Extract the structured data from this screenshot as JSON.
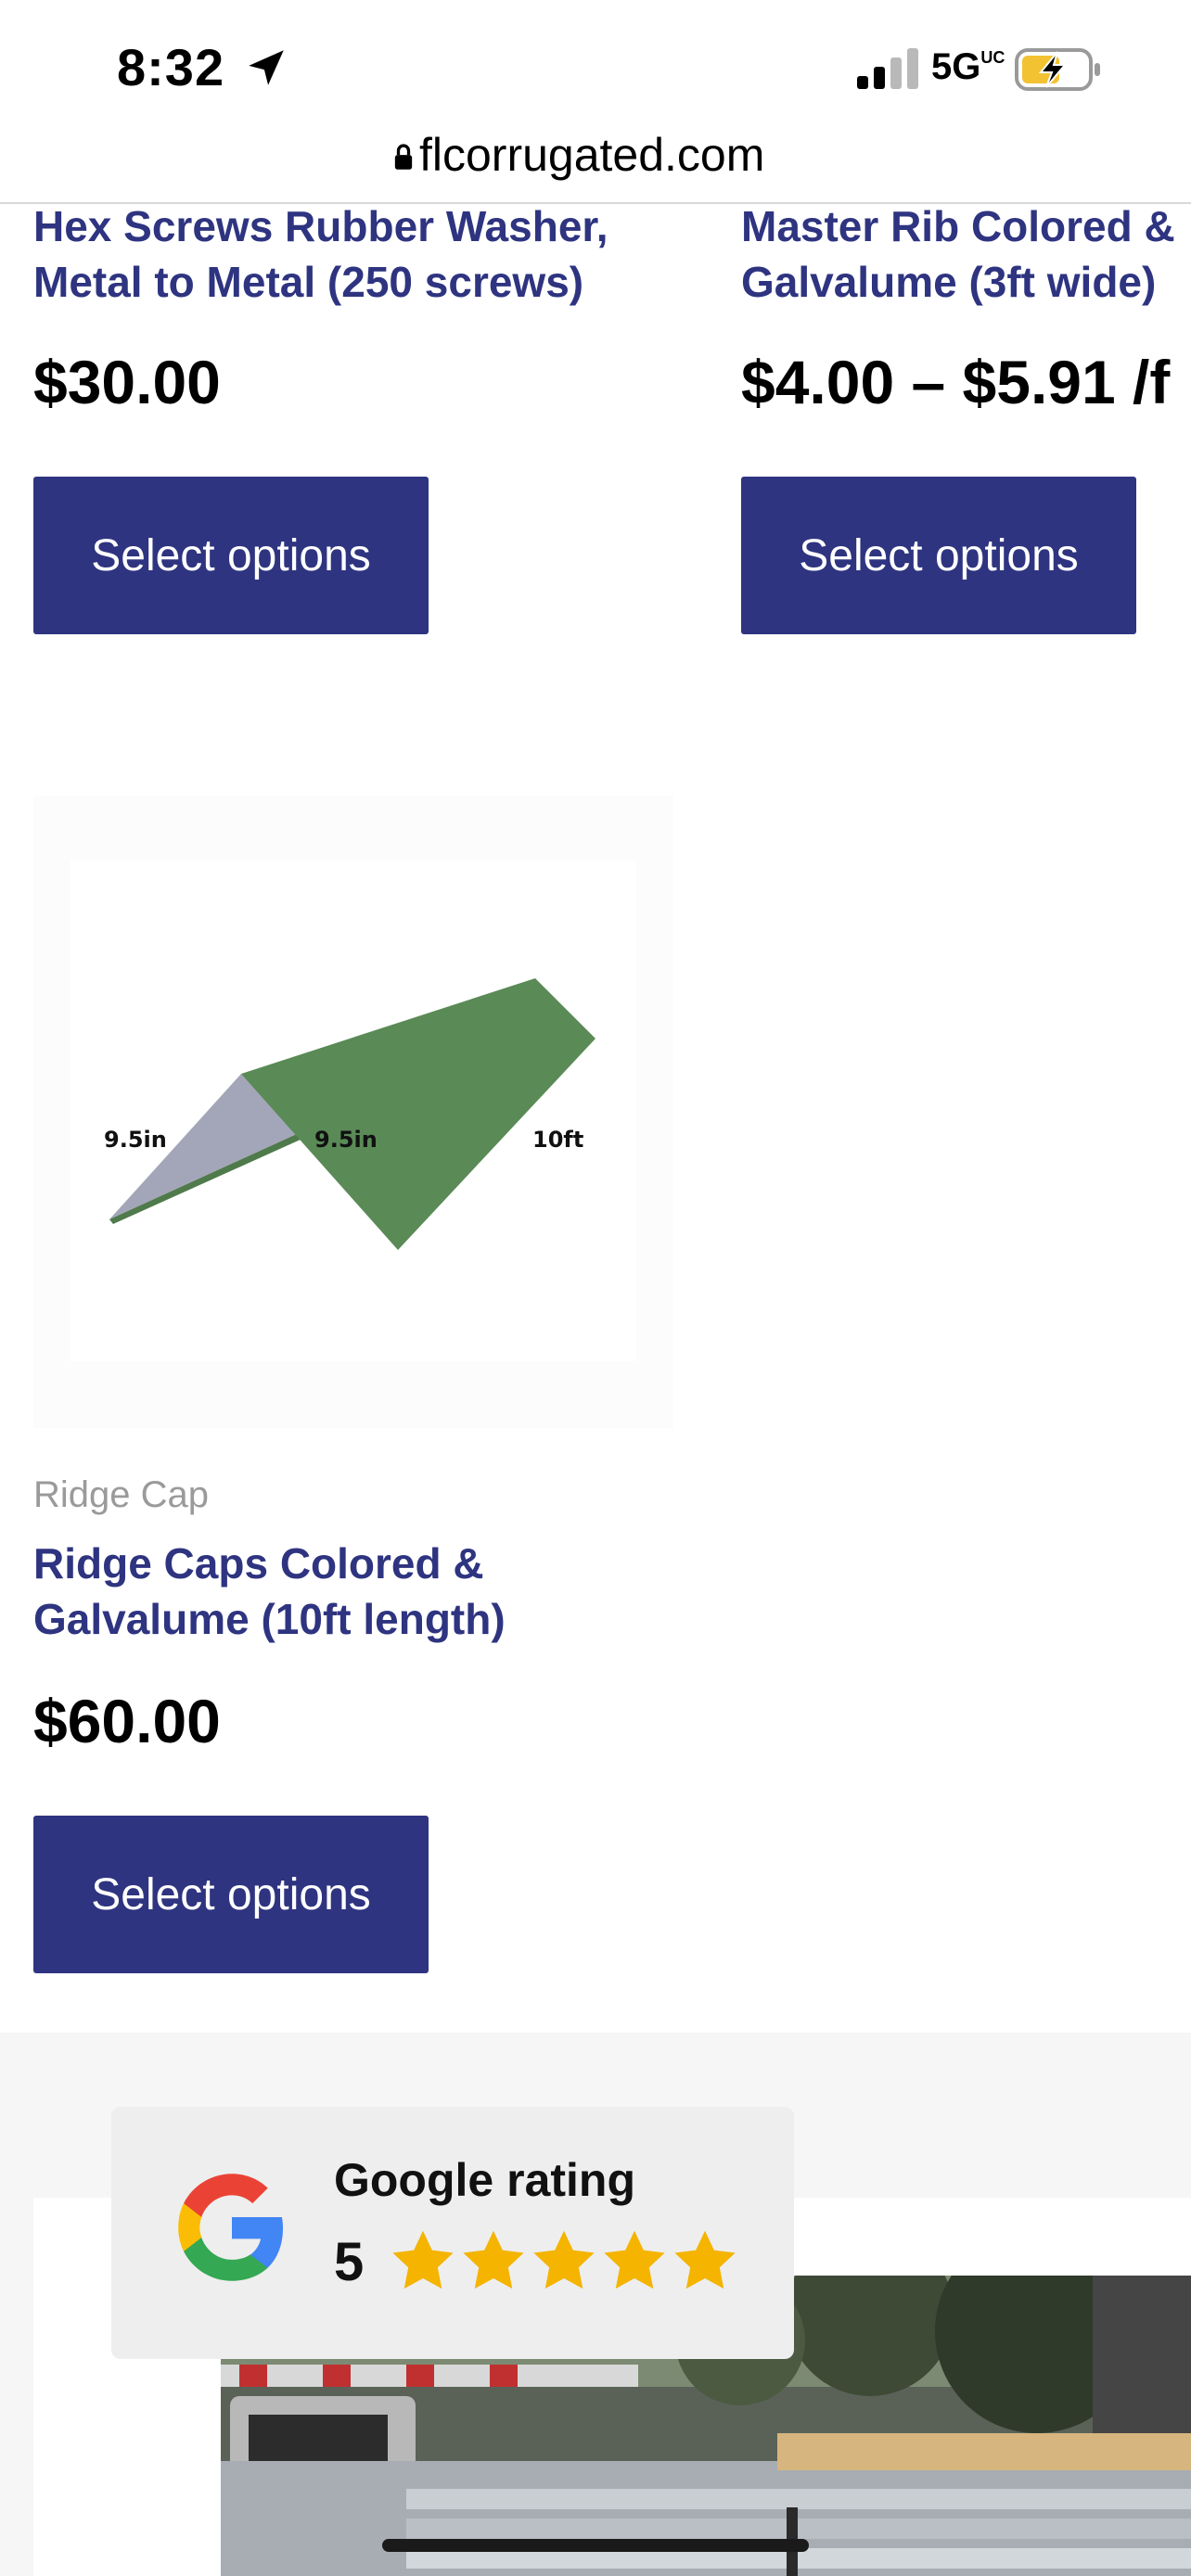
{
  "status_bar": {
    "time": "8:32",
    "network": "5G",
    "network_suffix": "UC",
    "icons": [
      "location-arrow-icon",
      "signal-icon",
      "battery-charging-icon"
    ]
  },
  "browser": {
    "url": "flcorrugated.com",
    "icon": "lock-icon"
  },
  "products": [
    {
      "title_line1": "Hex Screws Rubber Washer,",
      "title_line2": "Metal to Metal (250 screws)",
      "price": "$30.00",
      "button": "Select options"
    },
    {
      "title_line1": "Master Rib Colored &",
      "title_line2": "Galvalume (3ft wide)",
      "price": "$4.00 – $5.91 /f",
      "button": "Select options"
    },
    {
      "category": "Ridge Cap",
      "title_line1": "Ridge Caps Colored &",
      "title_line2": "Galvalume (10ft length)",
      "price": "$60.00",
      "button": "Select options",
      "image_labels": [
        "9.5in",
        "9.5in",
        "10ft"
      ],
      "colors": {
        "cap_green": "#5a8a56",
        "cap_grey": "#a3a6b8"
      }
    }
  ],
  "google_rating": {
    "title": "Google rating",
    "score": "5",
    "stars": 5
  },
  "colors": {
    "brand": "#2e3480",
    "star": "#f4b400"
  }
}
